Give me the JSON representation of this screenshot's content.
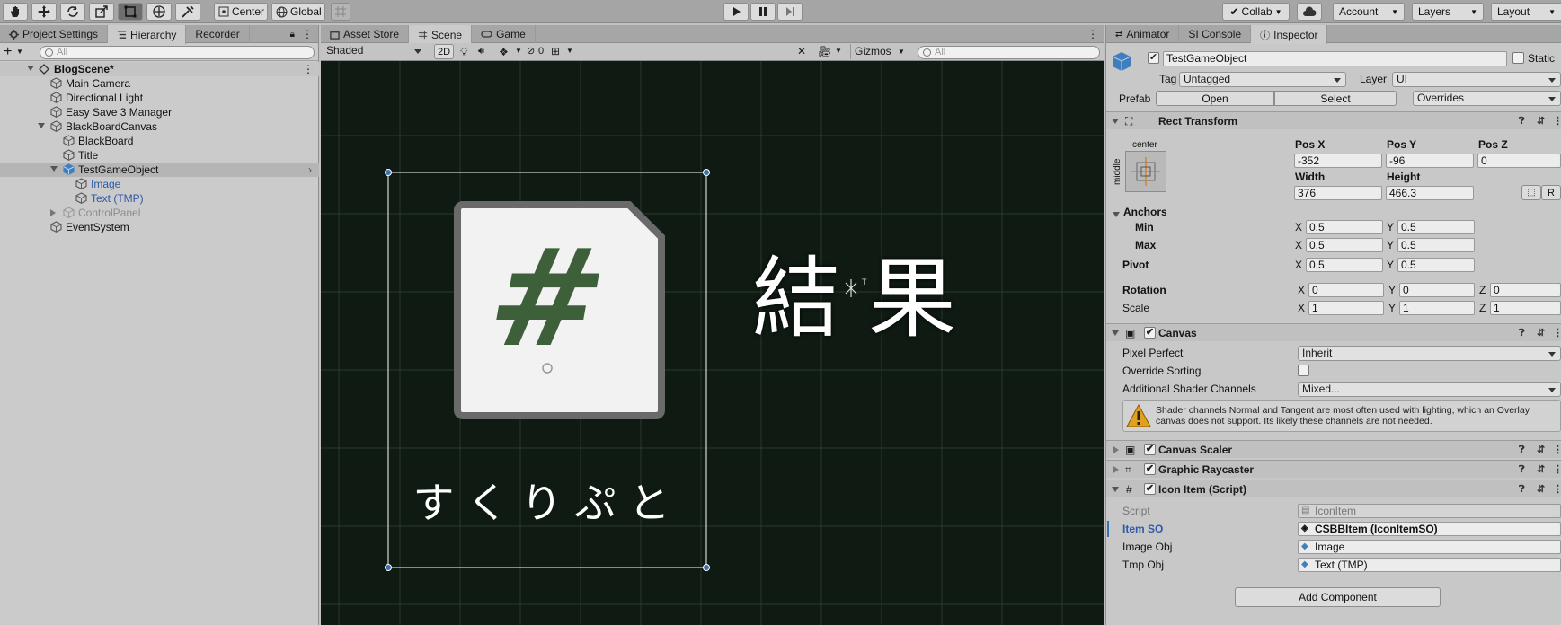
{
  "toolbar": {
    "pivot": "Center",
    "space": "Global",
    "collab": "Collab",
    "account": "Account",
    "layers": "Layers",
    "layout": "Layout"
  },
  "left": {
    "tabs": [
      "Project Settings",
      "Hierarchy",
      "Recorder"
    ],
    "search_placeholder": "All",
    "scene": "BlogScene*",
    "items": [
      "Main Camera",
      "Directional Light",
      "Easy Save 3 Manager",
      "BlackBoardCanvas",
      "BlackBoard",
      "Title",
      "TestGameObject",
      "Image",
      "Text (TMP)",
      "ControlPanel",
      "EventSystem"
    ]
  },
  "scene": {
    "tabs": [
      "Asset Store",
      "Scene",
      "Game"
    ],
    "shading": "Shaded",
    "mode2d": "2D",
    "hidden_count": "0",
    "gizmos": "Gizmos",
    "search_placeholder": "All",
    "card_symbol": "#",
    "caption": "すくりぷと",
    "result_text": "結 果"
  },
  "inspector": {
    "tabs": [
      "Animator",
      "SI Console",
      "Inspector"
    ],
    "object_name": "TestGameObject",
    "static_label": "Static",
    "tag_label": "Tag",
    "tag": "Untagged",
    "layer_label": "Layer",
    "layer": "UI",
    "prefab_label": "Prefab",
    "open": "Open",
    "select": "Select",
    "overrides": "Overrides",
    "rect": {
      "title": "Rect Transform",
      "anchor_h": "center",
      "anchor_v": "middle",
      "posx_label": "Pos X",
      "posy_label": "Pos Y",
      "posz_label": "Pos Z",
      "posx": "-352",
      "posy": "-96",
      "posz": "0",
      "width_label": "Width",
      "height_label": "Height",
      "width": "376",
      "height": "466.3",
      "r_btn": "R",
      "anchors": "Anchors",
      "min": "Min",
      "max": "Max",
      "pivot": "Pivot",
      "rotation": "Rotation",
      "scale": "Scale",
      "x": "X",
      "y": "Y",
      "z": "Z",
      "min_x": "0.5",
      "min_y": "0.5",
      "max_x": "0.5",
      "max_y": "0.5",
      "pivot_x": "0.5",
      "pivot_y": "0.5",
      "rot_x": "0",
      "rot_y": "0",
      "rot_z": "0",
      "scale_x": "1",
      "scale_y": "1",
      "scale_z": "1"
    },
    "canvas": {
      "title": "Canvas",
      "pixel_perfect": "Pixel Perfect",
      "pixel_perfect_val": "Inherit",
      "override_sorting": "Override Sorting",
      "shader_channels": "Additional Shader Channels",
      "shader_val": "Mixed...",
      "warning": "Shader channels Normal and Tangent are most often used with lighting, which an Overlay canvas does not support. Its likely these channels are not needed."
    },
    "scaler": "Canvas Scaler",
    "raycaster": "Graphic Raycaster",
    "icon_item": {
      "title": "Icon Item (Script)",
      "script_label": "Script",
      "script": "IconItem",
      "item_so_label": "Item SO",
      "item_so": "CSBBItem (IconItemSO)",
      "image_label": "Image Obj",
      "image": "Image",
      "tmp_label": "Tmp Obj",
      "tmp": "Text (TMP)"
    },
    "add_component": "Add Component"
  },
  "colors": {
    "scene_bg": "#0f1a12",
    "selection_blue": "#3a72b0",
    "card_green": "#3d5f3a"
  }
}
